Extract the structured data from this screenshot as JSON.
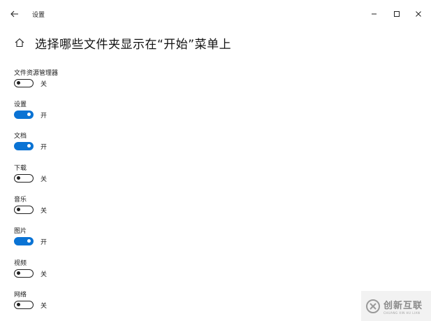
{
  "window": {
    "title": "设置",
    "controls": {
      "minimize": "–",
      "maximize": "□",
      "close": "✕"
    }
  },
  "header": {
    "title": "选择哪些文件夹显示在“开始”菜单上"
  },
  "settings": [
    {
      "label": "文件资源管理器",
      "state": "关",
      "on": false
    },
    {
      "label": "设置",
      "state": "开",
      "on": true
    },
    {
      "label": "文档",
      "state": "开",
      "on": true
    },
    {
      "label": "下载",
      "state": "关",
      "on": false
    },
    {
      "label": "音乐",
      "state": "关",
      "on": false
    },
    {
      "label": "图片",
      "state": "开",
      "on": true
    },
    {
      "label": "视频",
      "state": "关",
      "on": false
    },
    {
      "label": "网络",
      "state": "关",
      "on": false
    }
  ],
  "watermark": {
    "main": "创新互联",
    "sub": "CHUANG XIN HU LIAN"
  },
  "colors": {
    "accent": "#0a73d4",
    "toggle_off": "#1f1f1f",
    "background": "#ffffff"
  }
}
